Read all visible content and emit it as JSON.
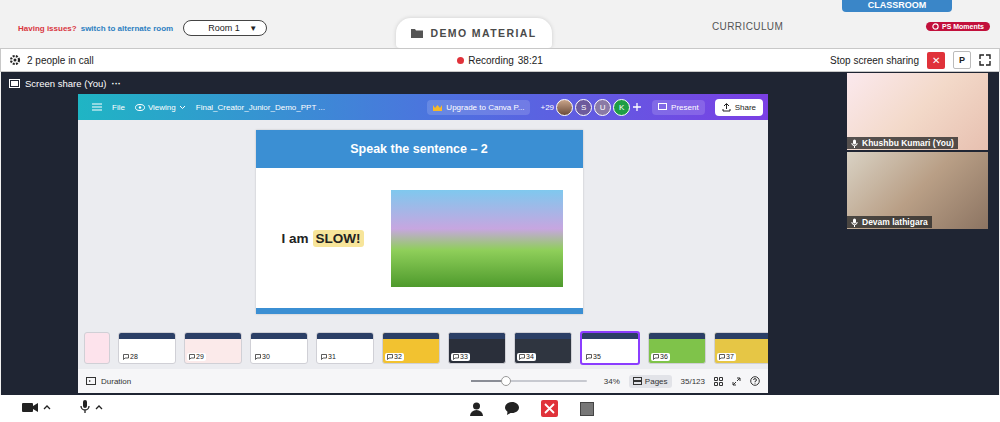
{
  "top_bar": {
    "issue": "Having issues?",
    "switch_link": "switch to alternate room",
    "room": "Room 1",
    "room_caret": "▼",
    "demo_button": "DEMO MATERIAL",
    "curriculum": "CURRICULUM",
    "classroom_tab": "CLASSROOM",
    "moments_badge": "PS Moments"
  },
  "call_bar": {
    "people": "2 people in call",
    "recording": "Recording",
    "recording_time": "38:21",
    "stop_sharing": "Stop screen sharing",
    "stop_button": "✕",
    "p_button": "P"
  },
  "share_tab": {
    "label": "Screen share (You)",
    "more": "···"
  },
  "canva": {
    "file": "File",
    "viewing": "Viewing",
    "title": "Final_Creator_Junior_Demo_PPT ...",
    "upgrade": "Upgrade to Canva P...",
    "collaborators_count": "+29",
    "avatars": [
      {
        "letter": "S",
        "color": "#6d5a9c"
      },
      {
        "letter": "U",
        "color": "#8a7aa6"
      },
      {
        "letter": "K",
        "color": "#1f9d45"
      }
    ],
    "present": "Present",
    "share": "Share"
  },
  "slide": {
    "title": "Speak the sentence – 2",
    "sentence": "I am",
    "highlight": "SLOW!"
  },
  "thumbnails": [
    {
      "page": "28",
      "selected": false,
      "color": "#ffffff"
    },
    {
      "page": "29",
      "selected": false,
      "color": "#fbeaea"
    },
    {
      "page": "30",
      "selected": false,
      "color": "#ffffff"
    },
    {
      "page": "31",
      "selected": false,
      "color": "#ffffff"
    },
    {
      "page": "32",
      "selected": false,
      "color": "#f2c230"
    },
    {
      "page": "33",
      "selected": false,
      "color": "#2a2f3a"
    },
    {
      "page": "34",
      "selected": false,
      "color": "#2f3540"
    },
    {
      "page": "35",
      "selected": true,
      "color": "#ffffff"
    },
    {
      "page": "36",
      "selected": false,
      "color": "#7fc34a"
    },
    {
      "page": "37",
      "selected": false,
      "color": "#e6c645"
    }
  ],
  "canva_footer": {
    "duration": "Duration",
    "zoom_level": 0.3,
    "zoom": "34%",
    "pages": "Pages",
    "page_count": "35/123"
  },
  "participants": [
    {
      "name": "Khushbu Kumari (You)"
    },
    {
      "name": "Devam lathigara"
    }
  ]
}
